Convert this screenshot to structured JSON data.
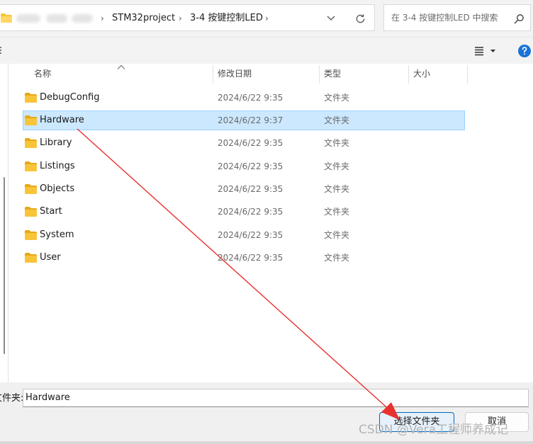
{
  "address_bar": {
    "crumbs": [
      "STM32project",
      "3-4 按键控制LED"
    ],
    "search_placeholder": "在 3-4 按键控制LED 中搜索"
  },
  "columns": {
    "name": "名称",
    "date": "修改日期",
    "type": "类型",
    "size": "大小"
  },
  "files": [
    {
      "name": "DebugConfig",
      "date": "2024/6/22 9:35",
      "type": "文件夹"
    },
    {
      "name": "Hardware",
      "date": "2024/6/22 9:37",
      "type": "文件夹",
      "selected": true
    },
    {
      "name": "Library",
      "date": "2024/6/22 9:35",
      "type": "文件夹"
    },
    {
      "name": "Listings",
      "date": "2024/6/22 9:35",
      "type": "文件夹"
    },
    {
      "name": "Objects",
      "date": "2024/6/22 9:35",
      "type": "文件夹"
    },
    {
      "name": "Start",
      "date": "2024/6/22 9:35",
      "type": "文件夹"
    },
    {
      "name": "System",
      "date": "2024/6/22 9:35",
      "type": "文件夹"
    },
    {
      "name": "User",
      "date": "2024/6/22 9:35",
      "type": "文件夹"
    }
  ],
  "footer": {
    "folder_label": "文件夹:",
    "folder_value": "Hardware",
    "select_button": "选择文件夹",
    "cancel_button": "取消"
  },
  "watermark": "CSDN @Vera工程师养成记",
  "icons": {
    "folder": "folder-icon",
    "chevron": "chevron-down-icon",
    "refresh": "refresh-icon",
    "search": "search-icon",
    "view": "view-options-icon",
    "help": "help-icon",
    "sort": "sort-up-icon"
  },
  "colors": {
    "selection_bg": "#cce8ff",
    "selection_border": "#99d1ff",
    "folder_yellow": "#f8c53a",
    "primary_border": "#0067c0",
    "annotation_arrow": "#e8322f",
    "help_blue": "#1a73d6"
  }
}
